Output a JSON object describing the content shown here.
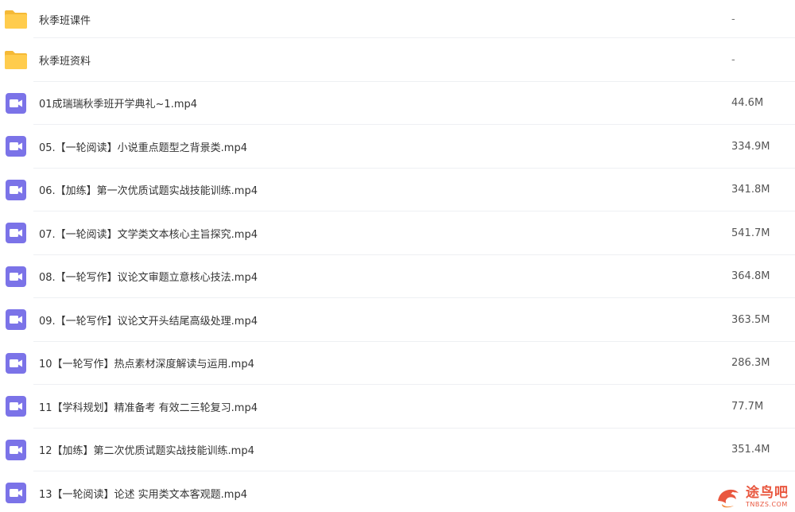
{
  "files": [
    {
      "type": "folder",
      "icon": "folder-icon",
      "name": "秋季班课件",
      "size": "-"
    },
    {
      "type": "folder",
      "icon": "folder-icon",
      "name": "秋季班资料",
      "size": "-"
    },
    {
      "type": "video",
      "icon": "video-icon",
      "name": "01成瑞瑞秋季班开学典礼~1.mp4",
      "size": "44.6M"
    },
    {
      "type": "video",
      "icon": "video-icon",
      "name": "05.【一轮阅读】小说重点题型之背景类.mp4",
      "size": "334.9M"
    },
    {
      "type": "video",
      "icon": "video-icon",
      "name": "06.【加练】第一次优质试题实战技能训练.mp4",
      "size": "341.8M"
    },
    {
      "type": "video",
      "icon": "video-icon",
      "name": "07.【一轮阅读】文学类文本核心主旨探究.mp4",
      "size": "541.7M"
    },
    {
      "type": "video",
      "icon": "video-icon",
      "name": "08.【一轮写作】议论文审题立意核心技法.mp4",
      "size": "364.8M"
    },
    {
      "type": "video",
      "icon": "video-icon",
      "name": "09.【一轮写作】议论文开头结尾高级处理.mp4",
      "size": "363.5M"
    },
    {
      "type": "video",
      "icon": "video-icon",
      "name": "10【一轮写作】热点素材深度解读与运用.mp4",
      "size": "286.3M"
    },
    {
      "type": "video",
      "icon": "video-icon",
      "name": "11【学科规划】精准备考 有效二三轮复习.mp4",
      "size": "77.7M"
    },
    {
      "type": "video",
      "icon": "video-icon",
      "name": "12【加练】第二次优质试题实战技能训练.mp4",
      "size": "351.4M"
    },
    {
      "type": "video",
      "icon": "video-icon",
      "name": "13【一轮阅读】论述 实用类文本客观题.mp4",
      "size": ""
    }
  ],
  "watermark": {
    "title": "途鸟吧",
    "subtitle": "TNBZS.COM"
  },
  "colors": {
    "folder": "#ffcc4d",
    "folder_tab": "#f5b936",
    "video": "#7b73e8",
    "separator": "#eef0f3",
    "watermark": "#e9573f"
  }
}
